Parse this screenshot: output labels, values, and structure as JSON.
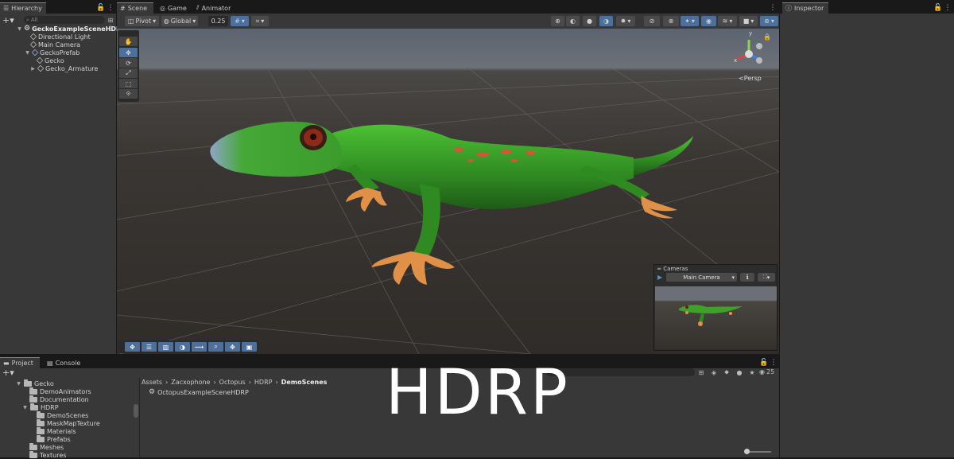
{
  "hierarchy": {
    "tab": "Hierarchy",
    "search_placeholder": "All",
    "items": [
      {
        "label": "GeckoExampleSceneHDRP",
        "level": 0,
        "kind": "scene"
      },
      {
        "label": "Directional Light",
        "level": 1,
        "kind": "object"
      },
      {
        "label": "Main Camera",
        "level": 1,
        "kind": "object"
      },
      {
        "label": "GeckoPrefab",
        "level": 1,
        "kind": "prefab"
      },
      {
        "label": "Gecko",
        "level": 2,
        "kind": "object"
      },
      {
        "label": "Gecko_Armature",
        "level": 2,
        "kind": "object"
      }
    ]
  },
  "scene_tabs": [
    {
      "label": "Scene",
      "icon": "grid-icon"
    },
    {
      "label": "Game",
      "icon": "gamepad-icon"
    },
    {
      "label": "Animator",
      "icon": "animator-icon"
    }
  ],
  "scene_toolbar": {
    "pivot": "Pivot",
    "global": "Global",
    "snap_value": "0.25"
  },
  "gizmo": {
    "axis_y": "y",
    "axis_x": "x",
    "persp": "Persp"
  },
  "cameras_overlay": {
    "title": "Cameras",
    "selected": "Main Camera"
  },
  "inspector": {
    "tab": "Inspector"
  },
  "bottom_tabs": [
    "Project",
    "Console"
  ],
  "project": {
    "breadcrumb": [
      "Assets",
      "Zacxophone",
      "Octopus",
      "HDRP",
      "DemoScenes"
    ],
    "tree": [
      {
        "label": "Gecko",
        "level": 0
      },
      {
        "label": "DemoAnimators",
        "level": 1
      },
      {
        "label": "Documentation",
        "level": 1
      },
      {
        "label": "HDRP",
        "level": 1
      },
      {
        "label": "DemoScenes",
        "level": 2
      },
      {
        "label": "MaskMapTexture",
        "level": 2
      },
      {
        "label": "Materials",
        "level": 2
      },
      {
        "label": "Prefabs",
        "level": 2
      },
      {
        "label": "Meshes",
        "level": 1
      },
      {
        "label": "Textures",
        "level": 1
      }
    ],
    "files": [
      "OctopusExampleSceneHDRP"
    ],
    "hidden_count": "25"
  },
  "overlay_text": "HDRP",
  "colors": {
    "accent": "#4a90d9",
    "active_tool": "#4c6f9b",
    "panel_bg": "#383838",
    "gecko_green": "#3fa02a"
  }
}
